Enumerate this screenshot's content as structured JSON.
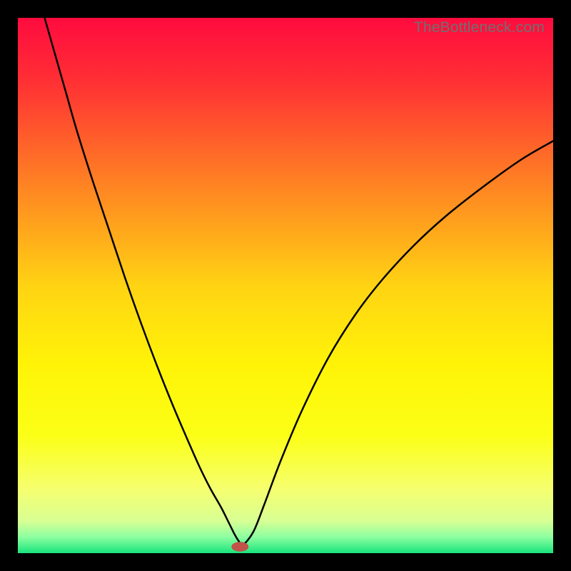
{
  "watermark": "TheBottleneck.com",
  "chart_data": {
    "type": "line",
    "title": "",
    "xlabel": "",
    "ylabel": "",
    "xlim": [
      0,
      100
    ],
    "ylim": [
      0,
      100
    ],
    "grid": false,
    "legend": false,
    "background": {
      "type": "vertical-gradient",
      "stops": [
        {
          "pos": 0.0,
          "color": "#ff0b3f"
        },
        {
          "pos": 0.12,
          "color": "#ff3034"
        },
        {
          "pos": 0.3,
          "color": "#ff7e24"
        },
        {
          "pos": 0.5,
          "color": "#ffd313"
        },
        {
          "pos": 0.65,
          "color": "#fff408"
        },
        {
          "pos": 0.78,
          "color": "#fbff16"
        },
        {
          "pos": 0.88,
          "color": "#f6ff6e"
        },
        {
          "pos": 0.94,
          "color": "#d8ff94"
        },
        {
          "pos": 0.97,
          "color": "#8dffa0"
        },
        {
          "pos": 1.0,
          "color": "#18e47b"
        }
      ]
    },
    "series": [
      {
        "name": "bottleneck-curve",
        "x": [
          5,
          7,
          9,
          11,
          14,
          17,
          20,
          23,
          26,
          29,
          32,
          34,
          36,
          38,
          39.5,
          40.5,
          41.3,
          42,
          44,
          46,
          49,
          53,
          58,
          63,
          68,
          74,
          80,
          87,
          94,
          100
        ],
        "y": [
          100,
          93,
          86,
          79,
          69.5,
          60.5,
          51.5,
          43,
          35,
          27.5,
          20.5,
          16,
          12,
          8.5,
          5.5,
          3.5,
          2.2,
          1.5,
          4,
          9,
          17,
          26.5,
          36.5,
          44.5,
          51,
          57.5,
          63,
          68.5,
          73.5,
          77
        ]
      }
    ],
    "marker": {
      "x": 41.5,
      "y": 1.2,
      "rx": 1.6,
      "ry": 0.9,
      "color": "#c1534a"
    }
  }
}
